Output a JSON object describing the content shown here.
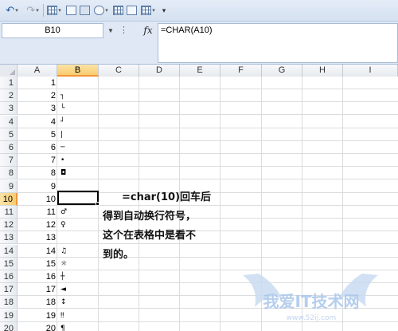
{
  "toolbar": {
    "undo_icon": "undo-icon",
    "redo_icon": "redo-icon"
  },
  "formula_bar": {
    "name_box": "B10",
    "fx_label": "fx",
    "formula": "=CHAR(A10)"
  },
  "columns": [
    "A",
    "B",
    "C",
    "D",
    "E",
    "F",
    "G",
    "H",
    "I"
  ],
  "selected_column": "B",
  "selected_row": "10",
  "rows": [
    {
      "row": "1",
      "a": "1",
      "b": ""
    },
    {
      "row": "2",
      "a": "2",
      "b": "┐"
    },
    {
      "row": "3",
      "a": "3",
      "b": "└"
    },
    {
      "row": "4",
      "a": "4",
      "b": "┘"
    },
    {
      "row": "5",
      "a": "5",
      "b": "|"
    },
    {
      "row": "6",
      "a": "6",
      "b": "─"
    },
    {
      "row": "7",
      "a": "7",
      "b": "•"
    },
    {
      "row": "8",
      "a": "8",
      "b": "◘"
    },
    {
      "row": "9",
      "a": "9",
      "b": ""
    },
    {
      "row": "10",
      "a": "10",
      "b": ""
    },
    {
      "row": "11",
      "a": "11",
      "b": "♂"
    },
    {
      "row": "12",
      "a": "12",
      "b": "♀"
    },
    {
      "row": "13",
      "a": "13",
      "b": ""
    },
    {
      "row": "14",
      "a": "14",
      "b": "♫"
    },
    {
      "row": "15",
      "a": "15",
      "b": "☼"
    },
    {
      "row": "16",
      "a": "16",
      "b": "┼"
    },
    {
      "row": "17",
      "a": "17",
      "b": "◄"
    },
    {
      "row": "18",
      "a": "18",
      "b": "↕"
    },
    {
      "row": "19",
      "a": "19",
      "b": "‼"
    },
    {
      "row": "20",
      "a": "20",
      "b": "¶"
    }
  ],
  "note": {
    "line1": "=char(10)回车后",
    "line2": "得到自动换行符号，",
    "line3": "这个在表格中是看不",
    "line4": "到的。"
  },
  "watermark": {
    "text": "我爱IT技术网",
    "url": "www.52ij.com"
  }
}
